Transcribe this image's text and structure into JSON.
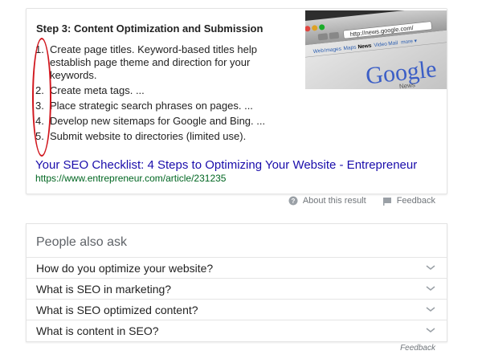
{
  "snippet": {
    "heading": "Step 3: Content Optimization and Submission",
    "items": [
      {
        "num": "1.",
        "text": "Create page titles. Keyword-based titles help establish page theme and direction for your keywords."
      },
      {
        "num": "2.",
        "text": "Create meta tags. ..."
      },
      {
        "num": "3.",
        "text": "Place strategic search phrases on pages. ..."
      },
      {
        "num": "4.",
        "text": "Develop new sitemaps for Google and Bing. ..."
      },
      {
        "num": "5.",
        "text": "Submit website to directories (limited use)."
      }
    ],
    "link_text": "Your SEO Checklist: 4 Steps to Optimizing Your Website - Entrepreneur",
    "url": "https://www.entrepreneur.com/article/231235",
    "thumbnail": {
      "address": "http://news.google.com/",
      "tabs": [
        "Web",
        "Images",
        "Maps",
        "News",
        "Video",
        "Mail",
        "more ▾"
      ],
      "logo": "Google",
      "sub_logo": "News"
    }
  },
  "about": {
    "about_label": "About this result",
    "feedback_label": "Feedback"
  },
  "paa": {
    "title": "People also ask",
    "questions": [
      "How do you optimize your website?",
      "What is SEO in marketing?",
      "What is SEO optimized content?",
      "What is content in SEO?"
    ]
  },
  "footer": {
    "feedback_label": "Feedback"
  },
  "colors": {
    "annotation": "#d1171e",
    "link": "#1a0dab",
    "url": "#006621"
  }
}
